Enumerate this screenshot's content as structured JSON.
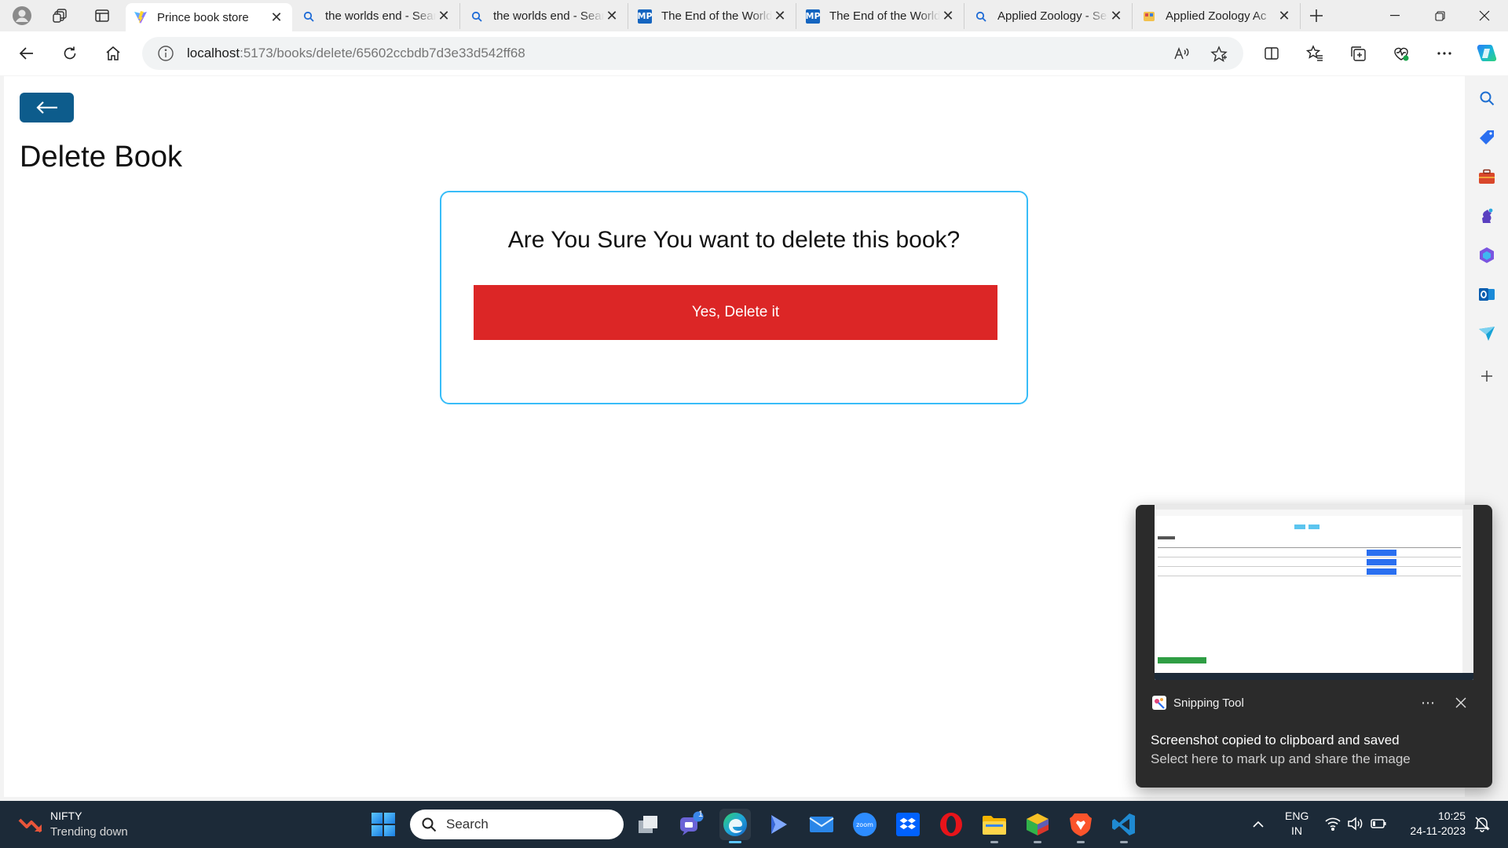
{
  "browser": {
    "tabs": [
      {
        "title": "Prince book store",
        "favicon": "vite-logo-icon",
        "active": true
      },
      {
        "title": "the worlds end - Search",
        "favicon": "search-icon",
        "active": false
      },
      {
        "title": "the worlds end - Search",
        "favicon": "search-icon",
        "active": false
      },
      {
        "title": "The End of the World",
        "favicon": "mp-icon",
        "favicon_text": "MP",
        "active": false
      },
      {
        "title": "The End of the World",
        "favicon": "mp-icon",
        "favicon_text": "MP",
        "active": false
      },
      {
        "title": "Applied Zoology - Search",
        "favicon": "search-icon",
        "active": false
      },
      {
        "title": "Applied Zoology Ac",
        "favicon": "book-icon",
        "active": false
      }
    ],
    "address": {
      "host": "localhost",
      "path": ":5173/books/delete/65602ccbdb7d3e33d542ff68"
    }
  },
  "page": {
    "title": "Delete Book",
    "confirm_message": "Are You Sure You want to delete this book?",
    "delete_button_label": "Yes, Delete it",
    "colors": {
      "back_button": "#0d5c8c",
      "delete_button": "#dc2626",
      "card_border": "#38bdf8"
    }
  },
  "toast": {
    "app_name": "Snipping Tool",
    "title": "Screenshot copied to clipboard and saved",
    "subtitle": "Select here to mark up and share the image"
  },
  "taskbar": {
    "widget": {
      "title": "NIFTY",
      "subtitle": "Trending down"
    },
    "search_placeholder": "Search",
    "teams_badge": "1",
    "language": {
      "line1": "ENG",
      "line2": "IN"
    },
    "clock": {
      "time": "10:25",
      "date": "24-11-2023"
    }
  }
}
